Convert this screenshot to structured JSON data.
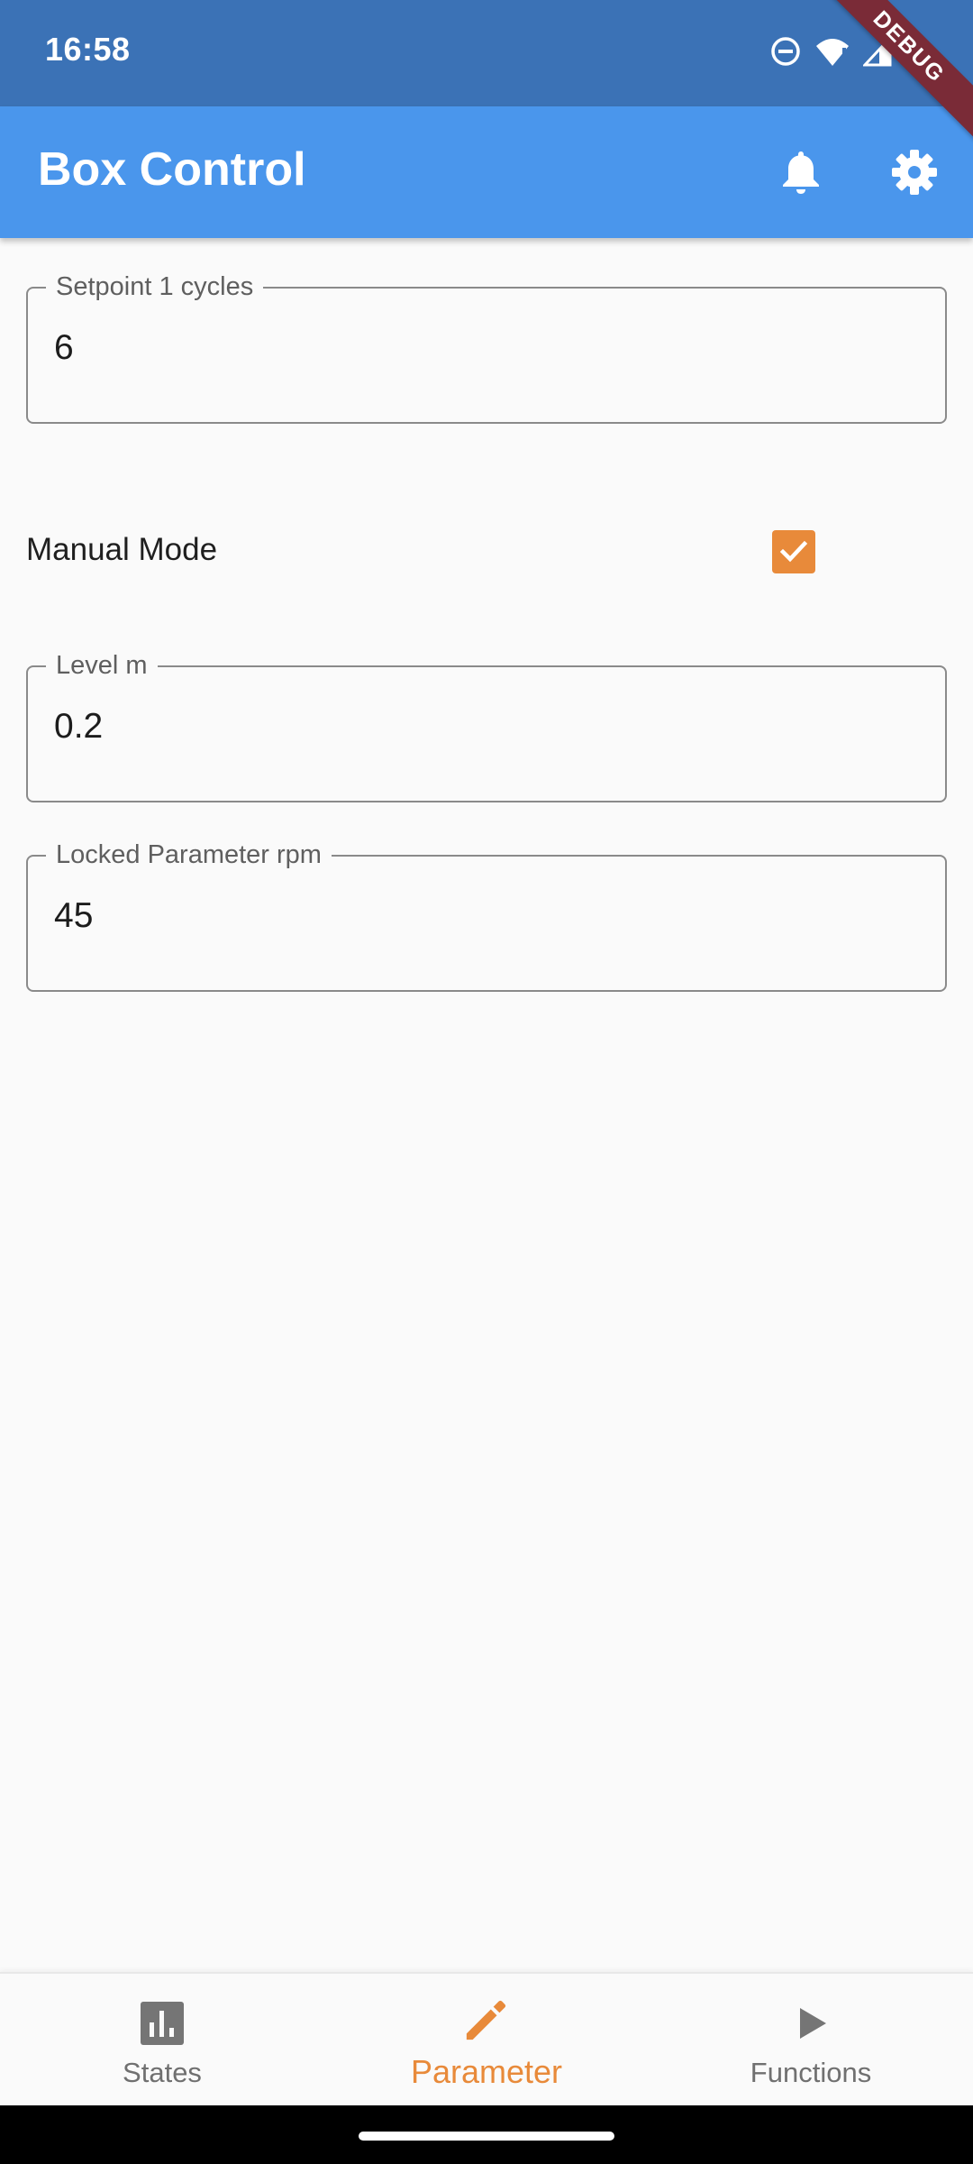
{
  "status_bar": {
    "time": "16:58"
  },
  "debug_banner": "DEBUG",
  "app_bar": {
    "title": "Box Control",
    "accent_color": "#4a96ec"
  },
  "form": {
    "setpoint": {
      "label": "Setpoint 1 cycles",
      "value": "6"
    },
    "manual_mode": {
      "label": "Manual Mode",
      "checked": true
    },
    "level": {
      "label": "Level m",
      "value": "0.2"
    },
    "locked_parameter": {
      "label": "Locked Parameter rpm",
      "value": "45"
    }
  },
  "bottom_nav": {
    "active_color": "#e88a3a",
    "items": [
      {
        "label": "States",
        "icon": "bar-chart-icon"
      },
      {
        "label": "Parameter",
        "icon": "pencil-icon",
        "active": true
      },
      {
        "label": "Functions",
        "icon": "play-icon"
      }
    ]
  }
}
